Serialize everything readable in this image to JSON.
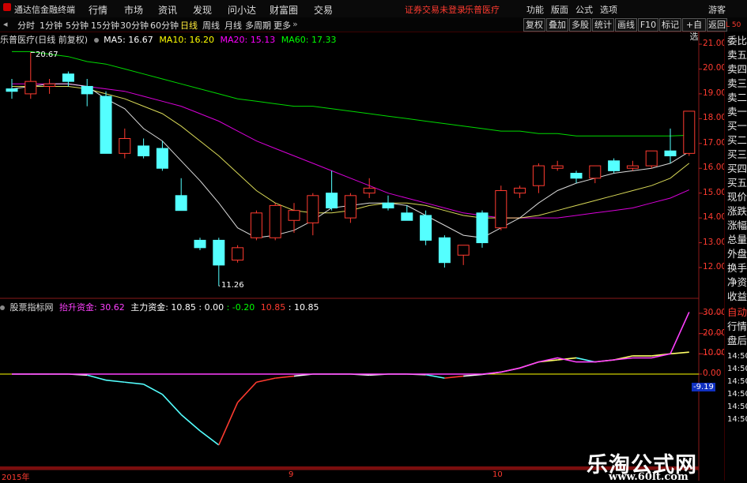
{
  "menubar": {
    "app_title": "通达信金融终端",
    "menus": [
      "行情",
      "市场",
      "资讯",
      "发现",
      "问小达",
      "财富圈",
      "交易"
    ],
    "notice": "证券交易未登录",
    "stock_name": "乐普医疗",
    "right_items": [
      "功能",
      "版面",
      "公式",
      "选项"
    ],
    "guest": "游客"
  },
  "toolbar": {
    "periods": [
      "分时",
      "1分钟",
      "5分钟",
      "15分钟",
      "30分钟",
      "60分钟",
      "日线",
      "周线",
      "月线",
      "多周期",
      "更多"
    ],
    "active_period": "日线",
    "more_arrow": "»",
    "buttons": [
      "复权",
      "叠加",
      "多股",
      "统计",
      "画线",
      "F10",
      "标记",
      "+自选",
      "返回"
    ]
  },
  "main_legend": {
    "stock": "乐普医疗(日线 前复权)",
    "ma5_label": "MA5: 16.67",
    "ma10_label": "MA10: 16.20",
    "ma20_label": "MA20: 15.13",
    "ma60_label": "MA60: 17.33",
    "colors": {
      "ma5": "#ffffff",
      "ma10": "#ffff00",
      "ma20": "#ff00ff",
      "ma60": "#00ff00"
    }
  },
  "sub_legend": {
    "title": "股票指标网",
    "item1": "抬升资金: 30.62",
    "item2": "主力资金: 10.85",
    "item3": ": 0.00",
    "item4": ": -0.20",
    "item5": "10.85",
    "item6": ": 10.85"
  },
  "annotations": {
    "high": "20.67",
    "low": "11.26",
    "last_value": "-9.19"
  },
  "right_panel": {
    "items": [
      "委比",
      "卖五",
      "卖四",
      "卖三",
      "卖二",
      "卖一",
      "买一",
      "买二",
      "买三",
      "买四",
      "买五",
      "现价",
      "涨跌",
      "涨幅",
      "总量",
      "外盘",
      "换手",
      "净资",
      "收益"
    ],
    "bottom_items": [
      "自动",
      "行情",
      "盘后"
    ],
    "times": [
      "14:50",
      "14:50",
      "14:50",
      "14:50",
      "14:50",
      "14:50"
    ],
    "corner": "L 50"
  },
  "footer": {
    "date_labels": [
      "2015年",
      "9",
      "10"
    ]
  },
  "watermark": {
    "line1": "乐淘公式网",
    "line2": "www.60lt.com"
  },
  "chart_data": {
    "type": "candlestick",
    "price_axis": {
      "ticks": [
        21.0,
        20.0,
        19.0,
        18.0,
        17.0,
        16.0,
        15.0,
        14.0,
        13.0,
        12.0
      ]
    },
    "indicator_axis": {
      "ticks": [
        30.0,
        20.0,
        10.0,
        0.0
      ]
    },
    "up_color": "#ff3b30",
    "down_color": "#54ffff",
    "candles": [
      {
        "o": 19.2,
        "h": 19.6,
        "l": 18.8,
        "c": 19.1
      },
      {
        "o": 19.0,
        "h": 20.67,
        "l": 18.8,
        "c": 19.5
      },
      {
        "o": 19.3,
        "h": 19.6,
        "l": 19.0,
        "c": 19.4
      },
      {
        "o": 19.8,
        "h": 19.9,
        "l": 19.3,
        "c": 19.5
      },
      {
        "o": 19.3,
        "h": 19.6,
        "l": 18.5,
        "c": 19.0
      },
      {
        "o": 18.9,
        "h": 19.1,
        "l": 16.6,
        "c": 16.6
      },
      {
        "o": 16.6,
        "h": 17.6,
        "l": 16.4,
        "c": 17.2
      },
      {
        "o": 16.9,
        "h": 17.2,
        "l": 16.4,
        "c": 16.5
      },
      {
        "o": 16.8,
        "h": 17.1,
        "l": 15.9,
        "c": 16.0
      },
      {
        "o": 14.9,
        "h": 15.6,
        "l": 14.3,
        "c": 14.3
      },
      {
        "o": 13.1,
        "h": 13.2,
        "l": 12.7,
        "c": 12.8
      },
      {
        "o": 13.1,
        "h": 13.2,
        "l": 11.26,
        "c": 12.1
      },
      {
        "o": 12.3,
        "h": 12.9,
        "l": 12.2,
        "c": 12.8
      },
      {
        "o": 13.2,
        "h": 14.3,
        "l": 13.1,
        "c": 14.2
      },
      {
        "o": 13.2,
        "h": 14.6,
        "l": 13.1,
        "c": 14.5
      },
      {
        "o": 13.9,
        "h": 14.6,
        "l": 13.4,
        "c": 14.3
      },
      {
        "o": 13.8,
        "h": 15.0,
        "l": 13.3,
        "c": 14.9
      },
      {
        "o": 15.0,
        "h": 15.9,
        "l": 14.3,
        "c": 14.4
      },
      {
        "o": 14.0,
        "h": 15.0,
        "l": 13.8,
        "c": 14.9
      },
      {
        "o": 15.0,
        "h": 15.6,
        "l": 14.8,
        "c": 15.2
      },
      {
        "o": 14.6,
        "h": 14.9,
        "l": 14.3,
        "c": 14.4
      },
      {
        "o": 14.2,
        "h": 14.5,
        "l": 13.9,
        "c": 13.9
      },
      {
        "o": 14.1,
        "h": 14.3,
        "l": 12.9,
        "c": 13.1
      },
      {
        "o": 13.2,
        "h": 13.3,
        "l": 12.0,
        "c": 12.2
      },
      {
        "o": 12.5,
        "h": 12.9,
        "l": 12.1,
        "c": 12.9
      },
      {
        "o": 14.2,
        "h": 14.3,
        "l": 12.8,
        "c": 13.0
      },
      {
        "o": 13.6,
        "h": 15.3,
        "l": 13.5,
        "c": 15.1
      },
      {
        "o": 15.0,
        "h": 15.3,
        "l": 14.8,
        "c": 15.2
      },
      {
        "o": 15.3,
        "h": 16.2,
        "l": 15.0,
        "c": 16.1
      },
      {
        "o": 16.0,
        "h": 16.3,
        "l": 15.9,
        "c": 16.1
      },
      {
        "o": 15.8,
        "h": 15.9,
        "l": 15.4,
        "c": 15.6
      },
      {
        "o": 15.6,
        "h": 16.1,
        "l": 15.4,
        "c": 16.1
      },
      {
        "o": 16.3,
        "h": 16.4,
        "l": 15.8,
        "c": 15.9
      },
      {
        "o": 16.0,
        "h": 16.3,
        "l": 15.9,
        "c": 16.1
      },
      {
        "o": 16.1,
        "h": 16.7,
        "l": 16.0,
        "c": 16.7
      },
      {
        "o": 16.7,
        "h": 17.6,
        "l": 16.2,
        "c": 16.5
      },
      {
        "o": 16.6,
        "h": 18.3,
        "l": 16.5,
        "c": 18.3
      }
    ],
    "ma5": [
      19.2,
      19.3,
      19.4,
      19.4,
      19.3,
      18.8,
      18.4,
      17.6,
      17.1,
      16.3,
      15.5,
      14.6,
      13.6,
      13.2,
      13.3,
      13.5,
      13.9,
      14.4,
      14.5,
      14.6,
      14.6,
      14.5,
      14.1,
      13.7,
      13.3,
      13.2,
      13.6,
      14.0,
      14.6,
      15.1,
      15.4,
      15.6,
      15.8,
      15.9,
      16.0,
      16.2,
      16.67
    ],
    "ma10": [
      19.3,
      19.3,
      19.3,
      19.3,
      19.2,
      19.0,
      18.8,
      18.5,
      18.2,
      17.7,
      17.1,
      16.5,
      15.8,
      15.1,
      14.6,
      14.3,
      14.2,
      14.2,
      14.3,
      14.5,
      14.6,
      14.6,
      14.5,
      14.3,
      14.1,
      14.0,
      14.0,
      14.0,
      14.1,
      14.3,
      14.5,
      14.7,
      14.9,
      15.1,
      15.3,
      15.6,
      16.2
    ],
    "ma20": [
      19.4,
      19.4,
      19.4,
      19.4,
      19.3,
      19.2,
      19.1,
      18.9,
      18.7,
      18.5,
      18.2,
      17.9,
      17.5,
      17.1,
      16.8,
      16.5,
      16.2,
      15.9,
      15.6,
      15.3,
      15.0,
      14.8,
      14.6,
      14.4,
      14.2,
      14.1,
      14.0,
      14.0,
      14.0,
      14.0,
      14.1,
      14.2,
      14.3,
      14.4,
      14.6,
      14.8,
      15.13
    ],
    "ma60": [
      20.7,
      20.7,
      20.6,
      20.5,
      20.3,
      20.2,
      20.0,
      19.8,
      19.6,
      19.4,
      19.2,
      19.0,
      18.8,
      18.7,
      18.6,
      18.5,
      18.5,
      18.4,
      18.3,
      18.2,
      18.1,
      18.0,
      17.9,
      17.8,
      17.7,
      17.6,
      17.5,
      17.5,
      17.4,
      17.4,
      17.3,
      17.3,
      17.3,
      17.3,
      17.3,
      17.3,
      17.33
    ],
    "indicator": {
      "fund_line": [
        0,
        0,
        0,
        0,
        -0.5,
        -3,
        -4,
        -5,
        -10,
        -20,
        -28,
        -35,
        -14,
        -4,
        -2,
        -1,
        0,
        0,
        0,
        -0.5,
        0,
        0,
        -0.3,
        -2,
        -1,
        -0.2,
        1,
        3,
        6,
        7,
        8,
        6,
        7,
        9,
        9,
        10,
        10.85
      ],
      "rise_line": [
        0,
        0,
        0,
        0,
        0,
        0,
        0,
        0,
        0,
        0,
        0,
        0,
        0,
        0,
        0,
        0,
        0,
        0,
        0,
        0,
        0,
        0,
        0,
        0,
        0,
        0,
        1,
        3,
        6,
        8,
        6,
        6,
        7,
        8,
        8,
        10,
        30.62
      ]
    }
  }
}
